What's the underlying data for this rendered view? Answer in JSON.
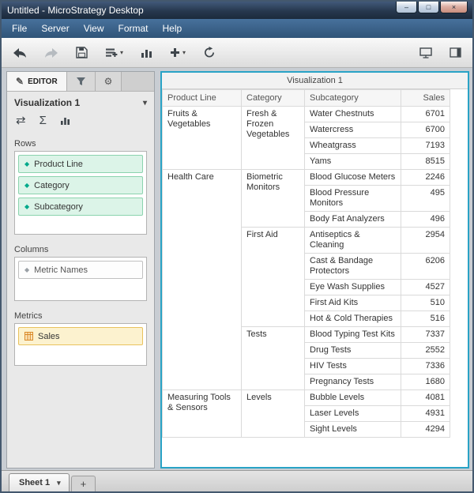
{
  "window": {
    "title": "Untitled - MicroStrategy Desktop"
  },
  "icons": {
    "minimize": "–",
    "maximize": "□",
    "close": "×",
    "caret_down": "▾",
    "pencil": "✎",
    "gear": "⚙",
    "sigma": "Σ",
    "swap": "⇄",
    "diamond": "◆",
    "plus": "+"
  },
  "menu": {
    "items": [
      "File",
      "Server",
      "View",
      "Format",
      "Help"
    ]
  },
  "editor": {
    "tab_label": "EDITOR",
    "visualization_name": "Visualization 1",
    "rows_label": "Rows",
    "columns_label": "Columns",
    "metrics_label": "Metrics",
    "rows_items": [
      "Product Line",
      "Category",
      "Subcategory"
    ],
    "columns_items": [
      "Metric Names"
    ],
    "metrics_items": [
      "Sales"
    ]
  },
  "visualization": {
    "title": "Visualization 1",
    "table": {
      "headers": [
        "Product Line",
        "Category",
        "Subcategory",
        "Sales"
      ],
      "groups": [
        {
          "product_line": "Fruits & Vegetables",
          "categories": [
            {
              "category": "Fresh & Frozen Vegetables",
              "rows": [
                {
                  "subcategory": "Water Chestnuts",
                  "sales": 6701
                },
                {
                  "subcategory": "Watercress",
                  "sales": 6700
                },
                {
                  "subcategory": "Wheatgrass",
                  "sales": 7193
                },
                {
                  "subcategory": "Yams",
                  "sales": 8515
                }
              ]
            }
          ]
        },
        {
          "product_line": "Health Care",
          "categories": [
            {
              "category": "Biometric Monitors",
              "rows": [
                {
                  "subcategory": "Blood Glucose Meters",
                  "sales": 2246
                },
                {
                  "subcategory": "Blood Pressure Monitors",
                  "sales": 495
                },
                {
                  "subcategory": "Body Fat Analyzers",
                  "sales": 496
                }
              ]
            },
            {
              "category": "First Aid",
              "rows": [
                {
                  "subcategory": "Antiseptics & Cleaning",
                  "sales": 2954
                },
                {
                  "subcategory": "Cast & Bandage Protectors",
                  "sales": 6206
                },
                {
                  "subcategory": "Eye Wash Supplies",
                  "sales": 4527
                },
                {
                  "subcategory": "First Aid Kits",
                  "sales": 510
                },
                {
                  "subcategory": "Hot & Cold Therapies",
                  "sales": 516
                }
              ]
            },
            {
              "category": "Tests",
              "rows": [
                {
                  "subcategory": "Blood Typing Test Kits",
                  "sales": 7337
                },
                {
                  "subcategory": "Drug Tests",
                  "sales": 2552
                },
                {
                  "subcategory": "HIV Tests",
                  "sales": 7336
                },
                {
                  "subcategory": "Pregnancy Tests",
                  "sales": 1680
                }
              ]
            }
          ]
        },
        {
          "product_line": "Measuring Tools & Sensors",
          "categories": [
            {
              "category": "Levels",
              "rows": [
                {
                  "subcategory": "Bubble Levels",
                  "sales": 4081
                },
                {
                  "subcategory": "Laser Levels",
                  "sales": 4931
                },
                {
                  "subcategory": "Sight Levels",
                  "sales": 4294
                }
              ]
            }
          ]
        }
      ]
    }
  },
  "sheets": {
    "active": "Sheet 1"
  }
}
